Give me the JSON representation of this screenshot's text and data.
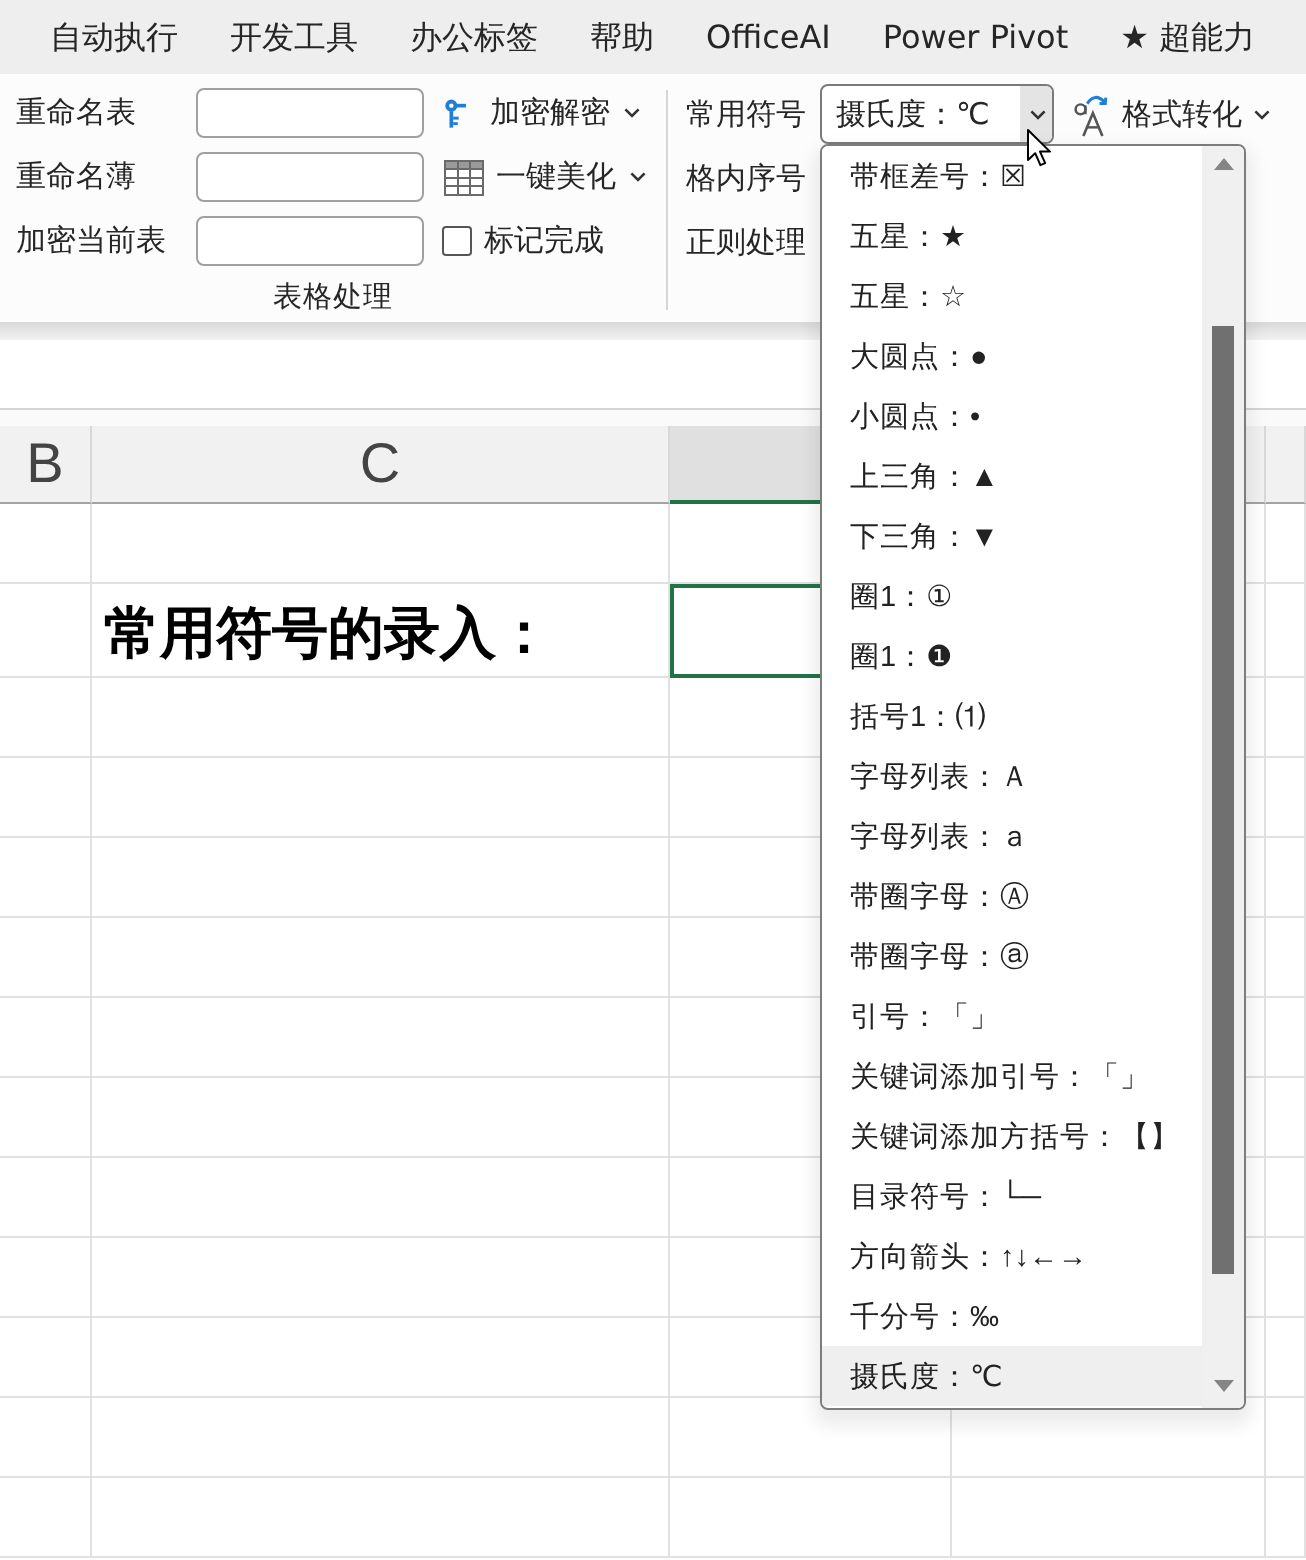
{
  "menu_tabs": [
    "自动执行",
    "开发工具",
    "办公标签",
    "帮助",
    "OfficeAI",
    "Power Pivot",
    "★ 超能力"
  ],
  "ribbon": {
    "table_group": {
      "fields": [
        {
          "label": "重命名表"
        },
        {
          "label": "重命名薄"
        },
        {
          "label": "加密当前表"
        }
      ],
      "tools": [
        {
          "kind": "menu",
          "label": "加密解密"
        },
        {
          "kind": "menu",
          "label": "一键美化"
        },
        {
          "kind": "checkbox",
          "label": "标记完成",
          "checked": false
        }
      ],
      "title": "表格处理"
    },
    "symbol_group": {
      "rows": [
        {
          "label": "常用符号"
        },
        {
          "label": "格内序号"
        },
        {
          "label": "正则处理"
        }
      ],
      "combo": {
        "value": "摄氏度：℃",
        "expanded": true,
        "options": [
          {
            "label": "带框差号：☒",
            "selected": false
          },
          {
            "label": "五星：★",
            "selected": false
          },
          {
            "label": "五星：☆",
            "selected": false
          },
          {
            "label": "大圆点：●",
            "selected": false
          },
          {
            "label": "小圆点：•",
            "selected": false
          },
          {
            "label": "上三角：▲",
            "selected": false
          },
          {
            "label": "下三角：▼",
            "selected": false
          },
          {
            "label": "圈1：①",
            "selected": false
          },
          {
            "label": "圈1：❶",
            "selected": false
          },
          {
            "label": "括号1：⑴",
            "selected": false
          },
          {
            "label": "字母列表：Ａ",
            "selected": false
          },
          {
            "label": "字母列表：ａ",
            "selected": false
          },
          {
            "label": "带圈字母：Ⓐ",
            "selected": false
          },
          {
            "label": "带圈字母：ⓐ",
            "selected": false
          },
          {
            "label": "引号：「」",
            "selected": false
          },
          {
            "label": "关键词添加引号：「」",
            "selected": false
          },
          {
            "label": "关键词添加方括号：【】",
            "selected": false
          },
          {
            "label": "目录符号：└─",
            "selected": false
          },
          {
            "label": "方向箭头：↑↓←→",
            "selected": false
          },
          {
            "label": "千分号：‰",
            "selected": false
          },
          {
            "label": "摄氏度：℃",
            "selected": true
          }
        ]
      },
      "format_button": {
        "label": "格式转化"
      }
    }
  },
  "sheet": {
    "columns": [
      {
        "label": "B",
        "selected": false
      },
      {
        "label": "C",
        "selected": false
      },
      {
        "selected": true
      },
      {
        "selected": false
      },
      {
        "selected": false
      }
    ],
    "rows": [
      {
        "selected": false
      },
      {
        "text": "常用符号的录入：",
        "selected": true
      }
    ]
  }
}
